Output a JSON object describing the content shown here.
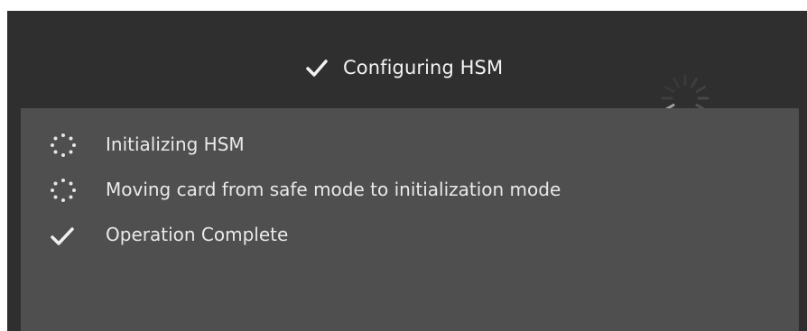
{
  "dialog": {
    "title": "Configuring HSM",
    "title_icon": "checkmark-icon",
    "busy_icon": "loading-spinner-icon"
  },
  "steps": [
    {
      "label": "Initializing HSM",
      "icon": "dotted-spinner-icon",
      "status": "in-progress"
    },
    {
      "label": "Moving card from safe mode to initialization mode",
      "icon": "dotted-spinner-icon",
      "status": "in-progress"
    },
    {
      "label": "Operation Complete",
      "icon": "checkmark-icon",
      "status": "complete"
    }
  ],
  "colors": {
    "dialog_background": "#2f2f2f",
    "panel_background": "#4f4f4f",
    "text": "#e9e9e9",
    "title_text": "#f2f2f2"
  }
}
